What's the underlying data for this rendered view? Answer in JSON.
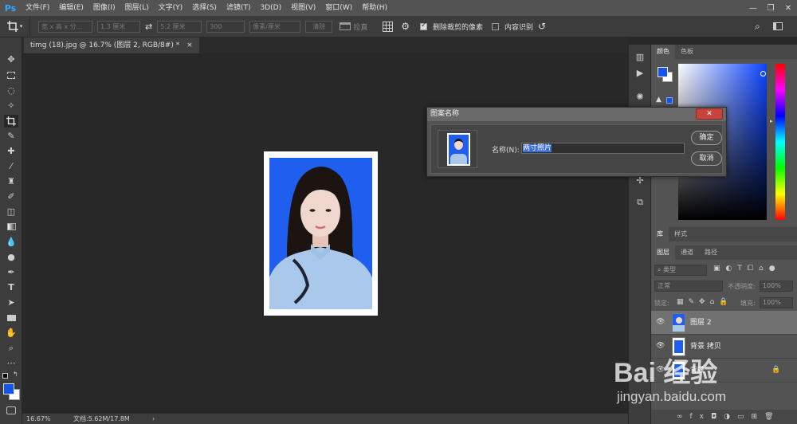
{
  "app": {
    "logo": "Ps"
  },
  "menubar": {
    "items": [
      "文件(F)",
      "编辑(E)",
      "图像(I)",
      "图层(L)",
      "文字(Y)",
      "选择(S)",
      "滤镜(T)",
      "3D(D)",
      "视图(V)",
      "窗口(W)",
      "帮助(H)"
    ]
  },
  "window_controls": {
    "minimize": "—",
    "restore": "❐",
    "close": "✕"
  },
  "options": {
    "ratio_preset": "宽 x 高 x 分...",
    "width": "1.3 厘米",
    "swap": "⇄",
    "height": "5.2 厘米",
    "resolution": "300",
    "resolution_unit": "像素/厘米",
    "clear": "清除",
    "straighten": "拉直",
    "delete_cropped": "删除裁剪的像素",
    "delete_cropped_checked": true,
    "content_aware": "内容识别",
    "content_aware_checked": false
  },
  "document": {
    "tab_title": "timg (18).jpg @ 16.7% (图层 2, RGB/8#) *",
    "tab_close": "×"
  },
  "statusbar": {
    "zoom": "16.67%",
    "doc_info": "文档:5.62M/17.8M",
    "arrow": "›"
  },
  "dialog": {
    "title": "图案名称",
    "close": "✕",
    "name_label": "名称(N):",
    "name_value": "两寸照片",
    "ok": "确定",
    "cancel": "取消"
  },
  "color_panel": {
    "tabs": [
      "颜色",
      "色板"
    ],
    "foreground": "#1755e8",
    "background": "#ffffff"
  },
  "library_panel": {
    "tabs": [
      "库",
      "样式"
    ]
  },
  "layers_panel": {
    "tabs": [
      "图层",
      "通道",
      "路径"
    ],
    "search_placeholder": "类型",
    "blend_mode": "正常",
    "opacity_label": "不透明度:",
    "opacity_value": "100%",
    "lock_label": "锁定:",
    "fill_label": "填充:",
    "fill_value": "100%",
    "layers": [
      {
        "name": "图层 2",
        "selected": true
      },
      {
        "name": "背景 拷贝",
        "selected": false
      },
      {
        "name": "背景",
        "selected": false
      }
    ]
  },
  "watermark": {
    "brand": "Bai 经验",
    "url": "jingyan.baidu.com"
  }
}
